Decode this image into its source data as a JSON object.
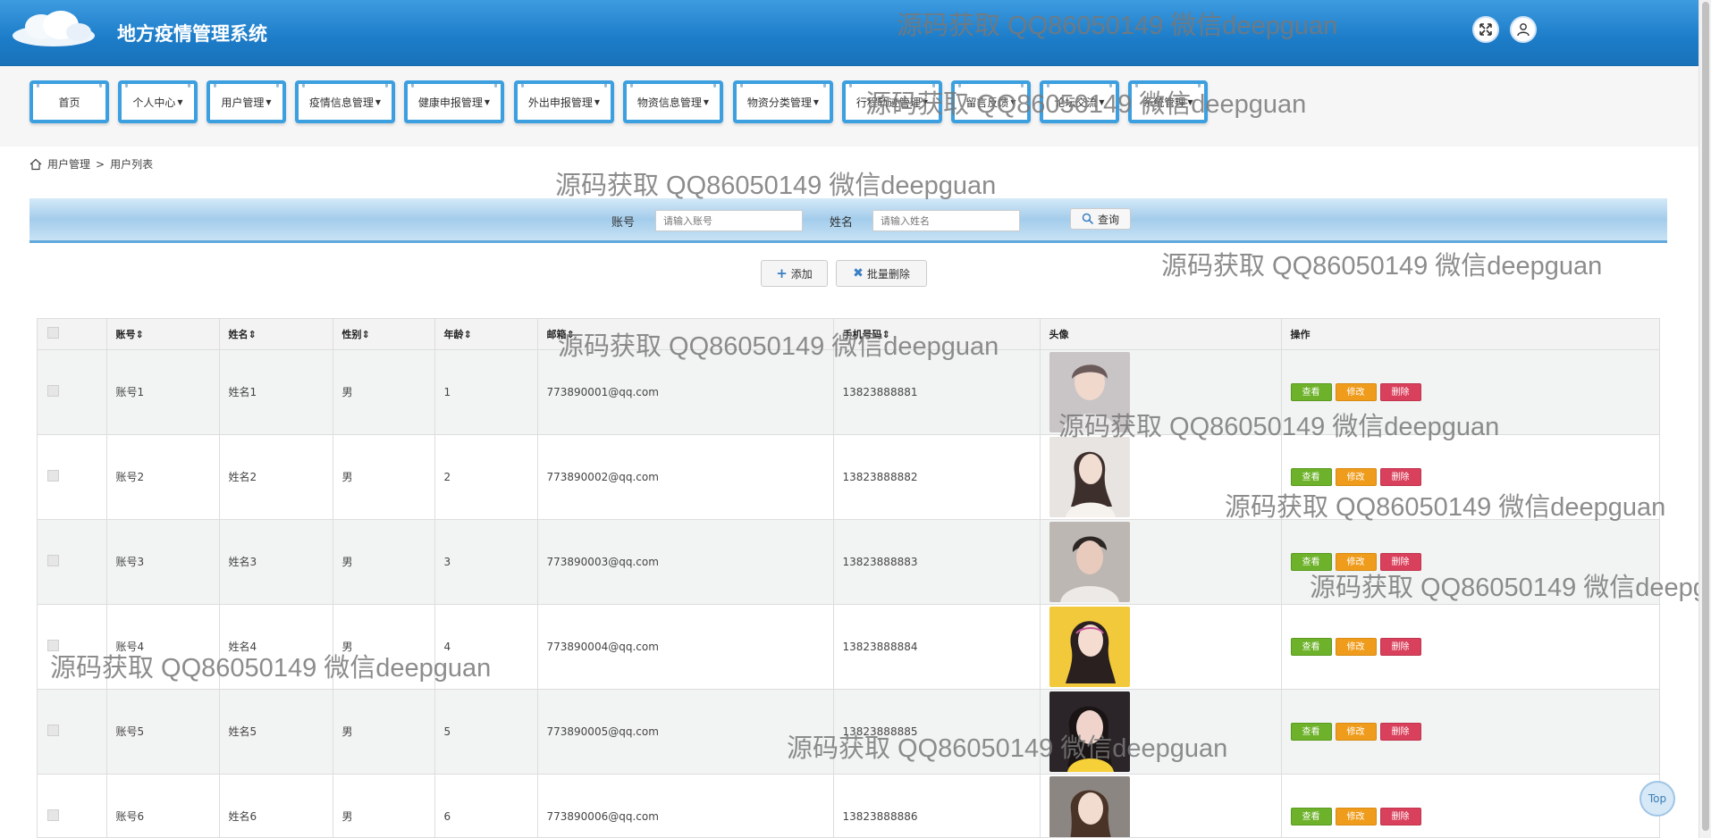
{
  "header": {
    "title": "地方疫情管理系统"
  },
  "nav": {
    "items": [
      {
        "label": "首页",
        "caret": false
      },
      {
        "label": "个人中心",
        "caret": true
      },
      {
        "label": "用户管理",
        "caret": true
      },
      {
        "label": "疫情信息管理",
        "caret": true
      },
      {
        "label": "健康申报管理",
        "caret": true
      },
      {
        "label": "外出申报管理",
        "caret": true
      },
      {
        "label": "物资信息管理",
        "caret": true
      },
      {
        "label": "物资分类管理",
        "caret": true
      },
      {
        "label": "行程轨迹管理",
        "caret": true
      },
      {
        "label": "留言反馈",
        "caret": true
      },
      {
        "label": "论坛交流",
        "caret": true
      },
      {
        "label": "系统管理",
        "caret": true
      }
    ]
  },
  "breadcrumb": {
    "section": "用户管理",
    "separator": ">",
    "page": "用户列表"
  },
  "search": {
    "account_label": "账号",
    "account_placeholder": "请输入账号",
    "name_label": "姓名",
    "name_placeholder": "请输入姓名",
    "query_label": "查询"
  },
  "actions": {
    "add_label": "添加",
    "batch_delete_label": "批量删除"
  },
  "table": {
    "headers": [
      "账号",
      "姓名",
      "性别",
      "年龄",
      "邮箱",
      "手机号码",
      "头像",
      "操作"
    ],
    "rows": [
      {
        "account": "账号1",
        "name": "姓名1",
        "gender": "男",
        "age": "1",
        "email": "773890001@qq.com",
        "phone": "13823888881"
      },
      {
        "account": "账号2",
        "name": "姓名2",
        "gender": "男",
        "age": "2",
        "email": "773890002@qq.com",
        "phone": "13823888882"
      },
      {
        "account": "账号3",
        "name": "姓名3",
        "gender": "男",
        "age": "3",
        "email": "773890003@qq.com",
        "phone": "13823888883"
      },
      {
        "account": "账号4",
        "name": "姓名4",
        "gender": "男",
        "age": "4",
        "email": "773890004@qq.com",
        "phone": "13823888884"
      },
      {
        "account": "账号5",
        "name": "姓名5",
        "gender": "男",
        "age": "5",
        "email": "773890005@qq.com",
        "phone": "13823888885"
      },
      {
        "account": "账号6",
        "name": "姓名6",
        "gender": "男",
        "age": "6",
        "email": "773890006@qq.com",
        "phone": "13823888886"
      }
    ],
    "op_labels": {
      "view": "查看",
      "edit": "修改",
      "delete": "删除"
    }
  },
  "watermark": "源码获取 QQ86050149 微信deepguan",
  "top_label": "Top",
  "colors": {
    "header": "#1c7cc8",
    "nav_border": "#3b9fe0",
    "view": "#6db22a",
    "edit": "#ef9c1c",
    "delete": "#d9405b"
  }
}
